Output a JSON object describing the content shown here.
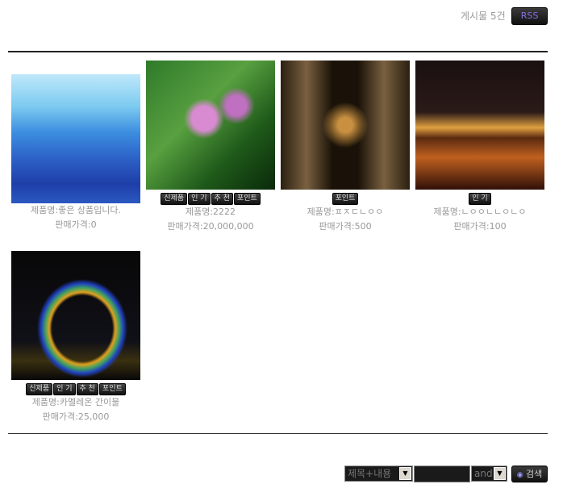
{
  "header": {
    "post_count": "게시물 5건",
    "rss_label": "RSS"
  },
  "products": [
    {
      "name": "제품명:좋은 상품입니다.",
      "price": "판매가격:0",
      "badges": []
    },
    {
      "name": "제품명:2222",
      "price": "판매가격:20,000,000",
      "badges": [
        "신제품",
        "인 기",
        "추 천",
        "포인트"
      ]
    },
    {
      "name": "제품명:ㅍㅈㄷㄴㅇㅇ",
      "price": "판매가격:500",
      "badges": [
        "포인트"
      ]
    },
    {
      "name": "제품명:ㄴㅇㅇㄴㄴㅇㄴㅇ",
      "price": "판매가격:100",
      "badges": [
        "인 기"
      ]
    },
    {
      "name": "제품명:카멜레온 간이물",
      "price": "판매가격:25,000",
      "badges": [
        "신제품",
        "인 기",
        "추 천",
        "포인트"
      ]
    }
  ],
  "search": {
    "field_select": "제목+내용",
    "query": "",
    "operator_select": "and",
    "search_button": "검색"
  }
}
